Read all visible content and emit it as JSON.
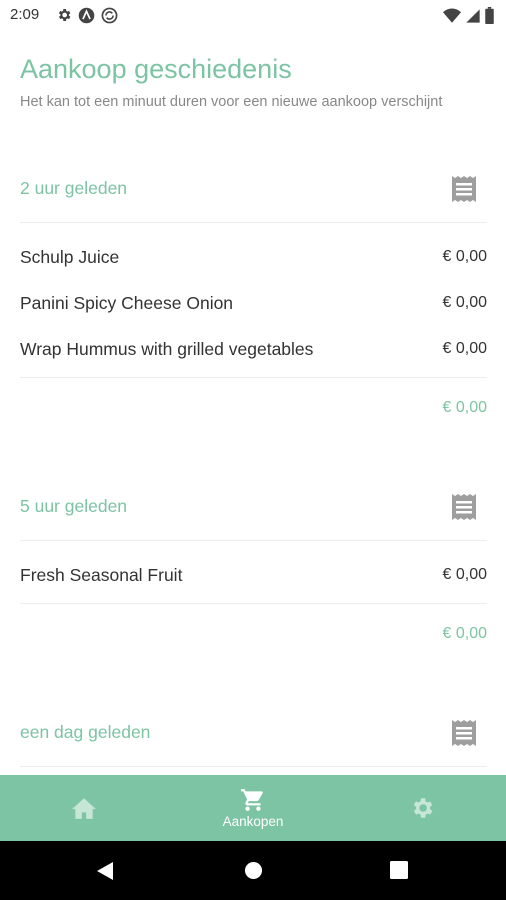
{
  "status_bar": {
    "time": "2:09",
    "left_icons": [
      "settings-icon",
      "app-icon",
      "sync-icon"
    ],
    "right_icons": [
      "wifi-icon",
      "signal-icon",
      "battery-icon"
    ]
  },
  "header": {
    "title": "Aankoop geschiedenis",
    "subtitle": "Het kan tot een minuut duren voor een nieuwe aankoop verschijnt"
  },
  "purchases": [
    {
      "time_label": "2 uur geleden",
      "items": [
        {
          "name": "Schulp Juice",
          "price": "€ 0,00"
        },
        {
          "name": "Panini Spicy Cheese Onion",
          "price": "€ 0,00"
        },
        {
          "name": "Wrap Hummus with grilled vegetables",
          "price": "€ 0,00"
        }
      ],
      "total": "€ 0,00"
    },
    {
      "time_label": "5 uur geleden",
      "items": [
        {
          "name": "Fresh Seasonal Fruit",
          "price": "€ 0,00"
        }
      ],
      "total": "€ 0,00"
    },
    {
      "time_label": "een dag geleden",
      "items": [],
      "total": ""
    }
  ],
  "bottom_nav": {
    "items": [
      {
        "icon": "home-icon",
        "label": ""
      },
      {
        "icon": "cart-icon",
        "label": "Aankopen"
      },
      {
        "icon": "gear-icon",
        "label": ""
      }
    ],
    "active_index": 1
  },
  "colors": {
    "accent": "#7cc4a3",
    "text": "#333333",
    "muted": "#888888",
    "icon_grey": "#9e9e9e"
  }
}
